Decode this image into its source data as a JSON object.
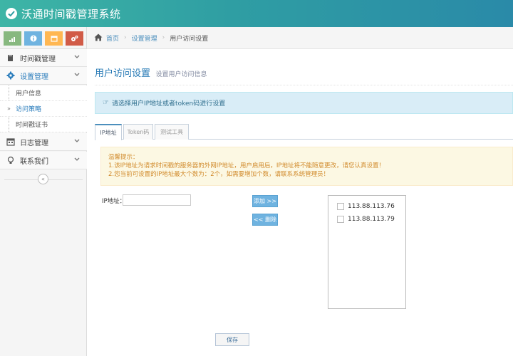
{
  "header": {
    "title": "沃通时间戳管理系统"
  },
  "shortcuts": [
    {
      "icon": "signal-icon",
      "color": "#87b87f"
    },
    {
      "icon": "info-icon",
      "color": "#6fb3e0"
    },
    {
      "icon": "calendar-icon",
      "color": "#ffb752"
    },
    {
      "icon": "cogs-icon",
      "color": "#d15b47"
    }
  ],
  "sidebar": {
    "items": [
      {
        "label": "时间戳管理",
        "icon": "book-icon"
      },
      {
        "label": "设置管理",
        "icon": "gear-icon"
      },
      {
        "label": "日志管理",
        "icon": "calendar-icon"
      },
      {
        "label": "联系我们",
        "icon": "lightbulb-icon"
      }
    ],
    "subitems": [
      {
        "label": "用户信息"
      },
      {
        "label": "访问策略"
      },
      {
        "label": "时间戳证书"
      }
    ],
    "collapse_glyph": "«"
  },
  "breadcrumb": {
    "home": "首页",
    "section": "设置管理",
    "current": "用户访问设置"
  },
  "page": {
    "title": "用户访问设置",
    "subtitle": "设置用户访问信息"
  },
  "info_alert": "请选择用户IP地址或者token码进行设置",
  "tabs": [
    {
      "label": "IP地址"
    },
    {
      "label": "Token码"
    },
    {
      "label": "测试工具"
    }
  ],
  "warning": {
    "title": "温馨提示：",
    "line1": "1.该IP地址为请求时间戳的服务器的外网IP地址，用户启用后，IP地址将不能随意更改，请您认真设置！",
    "line2": "2.您当前可设置的IP地址最大个数为：2个，如需要增加个数，请联系系统管理员！"
  },
  "form": {
    "ip_label": "IP地址：",
    "ip_value": "",
    "add_label": "添加 >>",
    "remove_label": "<< 删除",
    "ip_list": [
      "113.88.113.76",
      "113.88.113.79"
    ],
    "save_label": "保存"
  },
  "colors": {
    "accent": "#2b7dbc",
    "header": "#3aa8a6",
    "info_bg": "#d9edf7",
    "warn_bg": "#fcf8e3",
    "button_blue": "#6fb3e0"
  }
}
